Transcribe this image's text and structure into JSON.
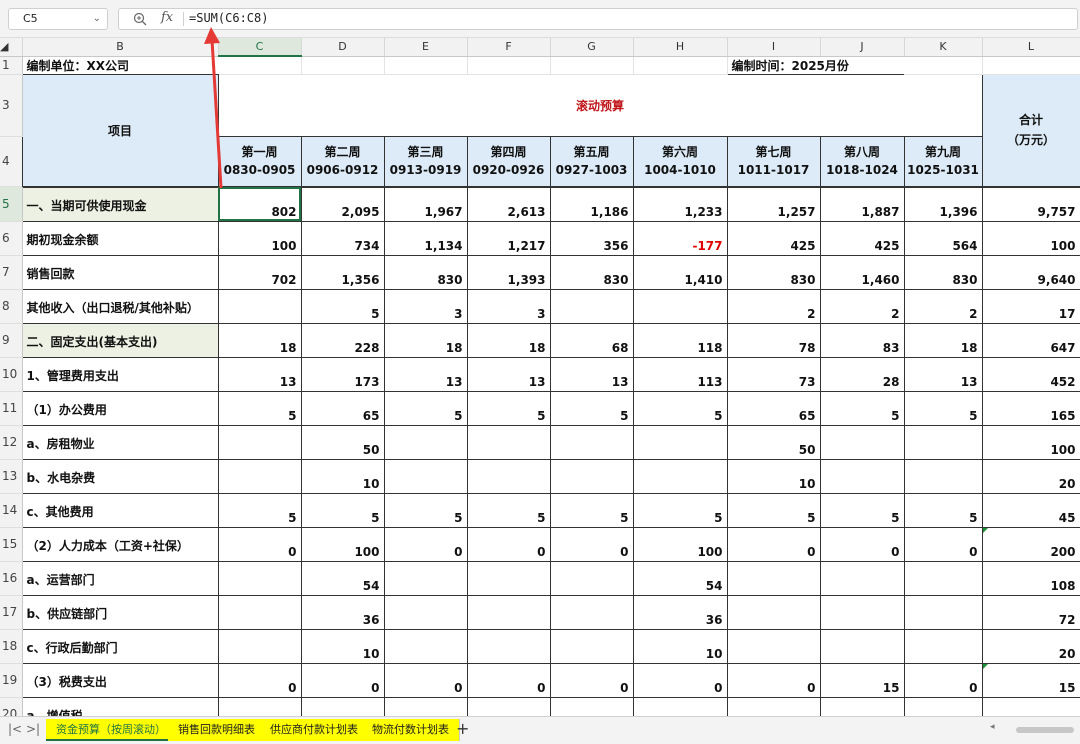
{
  "formula_bar": {
    "name_box": "C5",
    "fx_label": "fx",
    "formula": "=SUM(C6:C8)"
  },
  "columns": [
    "B",
    "C",
    "D",
    "E",
    "F",
    "G",
    "H",
    "I",
    "J",
    "K",
    "L"
  ],
  "row_numbers": [
    "1",
    "3",
    "4",
    "5",
    "6",
    "7",
    "8",
    "9",
    "10",
    "11",
    "12",
    "13",
    "14",
    "15",
    "16",
    "17",
    "18",
    "19",
    "20"
  ],
  "header": {
    "org": "编制单位：XX公司",
    "date": "编制时间：2025月份",
    "title": "滚动预算",
    "project_label": "项目",
    "total_label_1": "合计",
    "total_label_2": "（万元）",
    "weeks": [
      {
        "name": "第一周",
        "range": "0830-0905"
      },
      {
        "name": "第二周",
        "range": "0906-0912"
      },
      {
        "name": "第三周",
        "range": "0913-0919"
      },
      {
        "name": "第四周",
        "range": "0920-0926"
      },
      {
        "name": "第五周",
        "range": "0927-1003"
      },
      {
        "name": "第六周",
        "range": "1004-1010"
      },
      {
        "name": "第七周",
        "range": "1011-1017"
      },
      {
        "name": "第八周",
        "range": "1018-1024"
      },
      {
        "name": "第九周",
        "range": "1025-1031"
      }
    ]
  },
  "rows": [
    {
      "label": "一、当期可供使用现金",
      "values": [
        "802",
        "2,095",
        "1,967",
        "2,613",
        "1,186",
        "1,233",
        "1,257",
        "1,887",
        "1,396",
        "9,757"
      ]
    },
    {
      "label": "期初现金余额",
      "values": [
        "100",
        "734",
        "1,134",
        "1,217",
        "356",
        "-177",
        "425",
        "425",
        "564",
        "100"
      ]
    },
    {
      "label": "销售回款",
      "values": [
        "702",
        "1,356",
        "830",
        "1,393",
        "830",
        "1,410",
        "830",
        "1,460",
        "830",
        "9,640"
      ]
    },
    {
      "label": "其他收入（出口退税/其他补贴）",
      "values": [
        "",
        "5",
        "3",
        "3",
        "",
        "",
        "2",
        "2",
        "2",
        "17"
      ]
    },
    {
      "label": "二、固定支出(基本支出)",
      "values": [
        "18",
        "228",
        "18",
        "18",
        "68",
        "118",
        "78",
        "83",
        "18",
        "647"
      ]
    },
    {
      "label": "1、管理费用支出",
      "values": [
        "13",
        "173",
        "13",
        "13",
        "13",
        "113",
        "73",
        "28",
        "13",
        "452"
      ]
    },
    {
      "label": "（1）办公费用",
      "values": [
        "5",
        "65",
        "5",
        "5",
        "5",
        "5",
        "65",
        "5",
        "5",
        "165"
      ]
    },
    {
      "label": "a、房租物业",
      "values": [
        "",
        "50",
        "",
        "",
        "",
        "",
        "50",
        "",
        "",
        "100"
      ]
    },
    {
      "label": "b、水电杂费",
      "values": [
        "",
        "10",
        "",
        "",
        "",
        "",
        "10",
        "",
        "",
        "20"
      ]
    },
    {
      "label": "c、其他费用",
      "values": [
        "5",
        "5",
        "5",
        "5",
        "5",
        "5",
        "5",
        "5",
        "5",
        "45"
      ]
    },
    {
      "label": "（2）人力成本（工资+社保）",
      "values": [
        "0",
        "100",
        "0",
        "0",
        "0",
        "100",
        "0",
        "0",
        "0",
        "200"
      ]
    },
    {
      "label": "a、运营部门",
      "values": [
        "",
        "54",
        "",
        "",
        "",
        "54",
        "",
        "",
        "",
        "108"
      ]
    },
    {
      "label": "b、供应链部门",
      "values": [
        "",
        "36",
        "",
        "",
        "",
        "36",
        "",
        "",
        "",
        "72"
      ]
    },
    {
      "label": "c、行政后勤部门",
      "values": [
        "",
        "10",
        "",
        "",
        "",
        "10",
        "",
        "",
        "",
        "20"
      ]
    },
    {
      "label": "（3）税费支出",
      "values": [
        "0",
        "0",
        "0",
        "0",
        "0",
        "0",
        "0",
        "15",
        "0",
        "15"
      ]
    },
    {
      "label": "a、增值税",
      "values": [
        "",
        "",
        "",
        "",
        "",
        "",
        "",
        "",
        "",
        ""
      ]
    }
  ],
  "tabs": [
    "资金预算（按周滚动）",
    "销售回款明细表",
    "供应商付款计划表",
    "物流付数计划表"
  ],
  "add_tab_label": "+",
  "colors": {
    "accent": "#217346",
    "title_red": "#c0161b",
    "header_blue": "#dcebf7",
    "section_green": "#ecf1e3",
    "tab_yellow": "#ffff00",
    "negative": "#e00000",
    "arrow": "#e53935"
  }
}
